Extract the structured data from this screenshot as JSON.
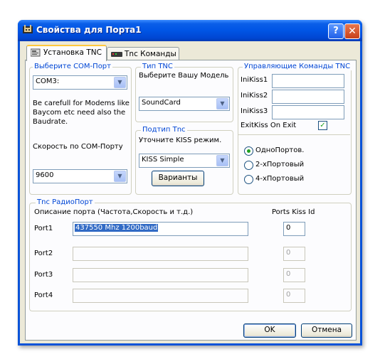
{
  "window": {
    "title": "Свойства для Порта1",
    "help_glyph": "?",
    "close_glyph": "✕"
  },
  "tabs": [
    {
      "label": "Установка TNC",
      "active": true
    },
    {
      "label": "Tnc Команды",
      "active": false
    }
  ],
  "com_port": {
    "legend": "Выберите COM-Порт",
    "selected": "COM3:",
    "note": [
      "Be carefull for Modems like",
      "Baycom etc need also the",
      "Baudrate."
    ],
    "speed_label": "Скорость по COM-Порту",
    "speed": "9600"
  },
  "tnc_type": {
    "legend": "Тип TNC",
    "prompt": "Выберите Вашу Модель",
    "selected": "SoundCard"
  },
  "tnc_subtype": {
    "legend": "Подтип Tnc",
    "prompt": "Уточните KISS режим.",
    "selected": "KISS Simple",
    "variants_button": "Варианты"
  },
  "control_commands": {
    "legend": "Управляющие Команды TNC",
    "fields": [
      {
        "label": "IniKiss1",
        "value": ""
      },
      {
        "label": "IniKiss2",
        "value": ""
      },
      {
        "label": "IniKiss3",
        "value": ""
      }
    ],
    "exit_kiss_label": "ExitKiss On Exit",
    "exit_kiss_checked": true,
    "port_modes": [
      {
        "label": "ОдноПортов.",
        "selected": true
      },
      {
        "label": "2-хПортовый",
        "selected": false
      },
      {
        "label": "4-хПортовый",
        "selected": false
      }
    ]
  },
  "radio_ports": {
    "legend": "Tnc РадиоПорт",
    "description_header": "Описание порта (Частота,Скорость и т.д.)",
    "kiss_id_header": "Ports Kiss Id",
    "ports": [
      {
        "label": "Port1",
        "description": "437550 Mhz 1200baud",
        "kiss_id": "0",
        "enabled": true
      },
      {
        "label": "Port2",
        "description": "",
        "kiss_id": "0",
        "enabled": false
      },
      {
        "label": "Port3",
        "description": "",
        "kiss_id": "0",
        "enabled": false
      },
      {
        "label": "Port4",
        "description": "",
        "kiss_id": "0",
        "enabled": false
      }
    ]
  },
  "footer": {
    "ok": "OK",
    "cancel": "Отмена"
  },
  "colors": {
    "title_bar": "#0055e5",
    "legend_text": "#0046d5",
    "face": "#ece9d8",
    "selection": "#316ac5"
  }
}
